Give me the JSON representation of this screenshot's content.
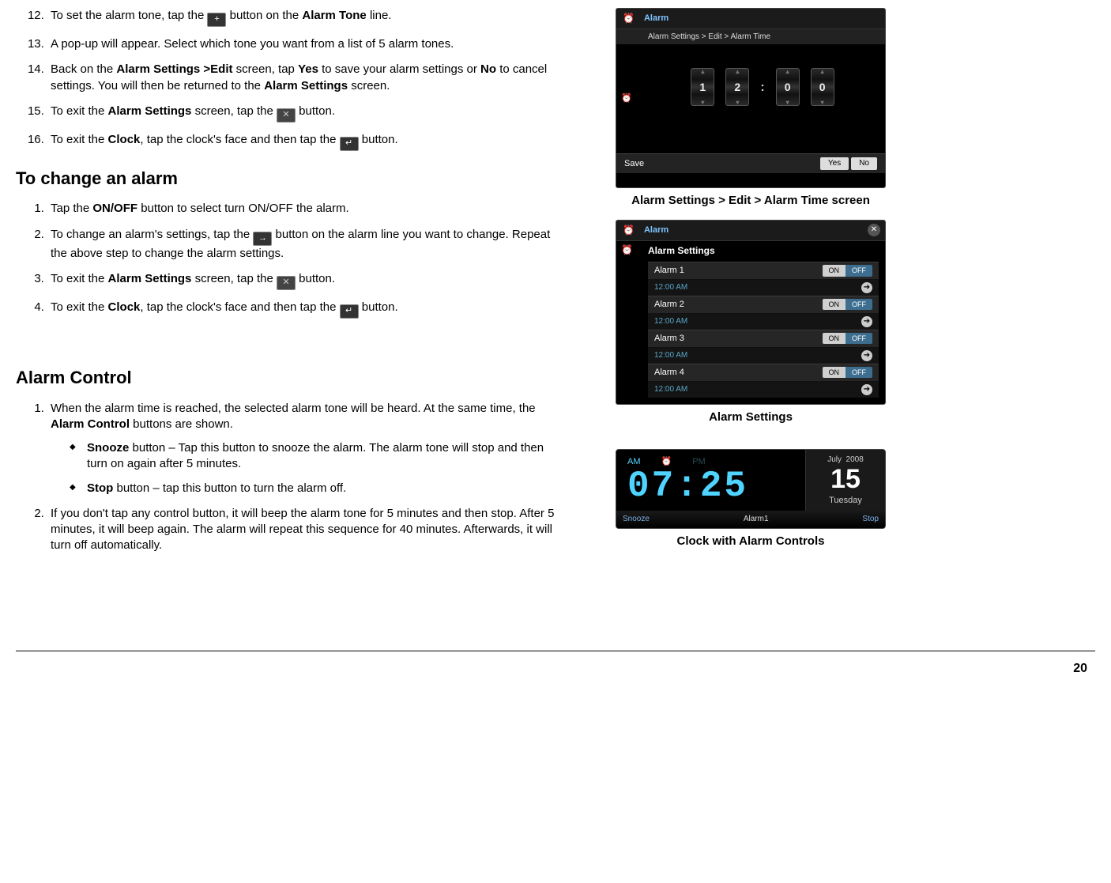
{
  "list1": {
    "i12a": "To set the alarm tone, tap the ",
    "i12b": " button on the ",
    "i12bold": "Alarm Tone",
    "i12c": " line.",
    "i13": "A pop-up will appear.  Select which tone you want from a list of 5 alarm tones.",
    "i14a": "Back on the ",
    "i14b": "Alarm Settings >Edit",
    "i14c": " screen, tap ",
    "i14yes": "Yes",
    "i14d": " to save your alarm settings or ",
    "i14no": "No",
    "i14e": " to cancel settings.  You will then be returned to the ",
    "i14f": "Alarm Settings",
    "i14g": " screen.",
    "i15a": "To exit the ",
    "i15b": "Alarm Settings",
    "i15c": " screen, tap the ",
    "i15d": " button.",
    "i16a": "To exit the ",
    "i16b": "Clock",
    "i16c": ", tap the clock's face and then tap the ",
    "i16d": " button."
  },
  "h_change": "To change an alarm",
  "list2": {
    "i1a": "Tap the ",
    "i1b": "ON/OFF",
    "i1c": " button to select turn ON/OFF the alarm.",
    "i2a": "To change an alarm's settings, tap the ",
    "i2b": " button on the alarm line you want to change.  Repeat the above step to change the alarm settings.",
    "i3a": "To exit the ",
    "i3b": "Alarm Settings",
    "i3c": " screen, tap the ",
    "i3d": " button.",
    "i4a": "To exit the ",
    "i4b": "Clock",
    "i4c": ", tap the clock's face and then tap the ",
    "i4d": " button."
  },
  "h_control": "Alarm Control",
  "list3": {
    "i1a": "When the alarm time is reached, the selected alarm tone will be heard.  At the same time, the ",
    "i1b": "Alarm Control",
    "i1c": " buttons are shown.",
    "snz_b": "Snooze",
    "snz_t": " button – Tap this button to snooze the alarm.  The alarm tone will stop and then turn on again after 5 minutes.",
    "stp_b": "Stop",
    "stp_t": " button – tap this button to turn the alarm off.",
    "i2a": "If you don't tap any control button,",
    "i2b": " it will beep the alarm tone for 5 minutes and then stop.  After 5 minutes, it will beep again.  The alarm will repeat this sequence for 40 minutes.  Afterwards, it will turn off automatically."
  },
  "fig1": {
    "caption": "Alarm Settings > Edit > Alarm Time screen",
    "title": "Alarm",
    "breadcrumb": "Alarm Settings > Edit > Alarm Time",
    "d1": "1",
    "d2": "2",
    "d3": "0",
    "d4": "0",
    "save": "Save",
    "yes": "Yes",
    "no": "No"
  },
  "fig2": {
    "caption": "Alarm Settings",
    "title": "Alarm",
    "subtitle": "Alarm Settings",
    "alarms": [
      {
        "name": "Alarm 1",
        "time": "12:00 AM"
      },
      {
        "name": "Alarm 2",
        "time": "12:00 AM"
      },
      {
        "name": "Alarm 3",
        "time": "12:00 AM"
      },
      {
        "name": "Alarm 4",
        "time": "12:00 AM"
      }
    ],
    "on": "ON",
    "off": "OFF"
  },
  "fig3": {
    "caption": "Clock with Alarm Controls",
    "am": "AM",
    "pm": "PM",
    "time": "07:25",
    "month": "July",
    "year": "2008",
    "day": "15",
    "dow": "Tuesday",
    "snooze": "Snooze",
    "alarm": "Alarm1",
    "stop": "Stop"
  },
  "page_no": "20"
}
